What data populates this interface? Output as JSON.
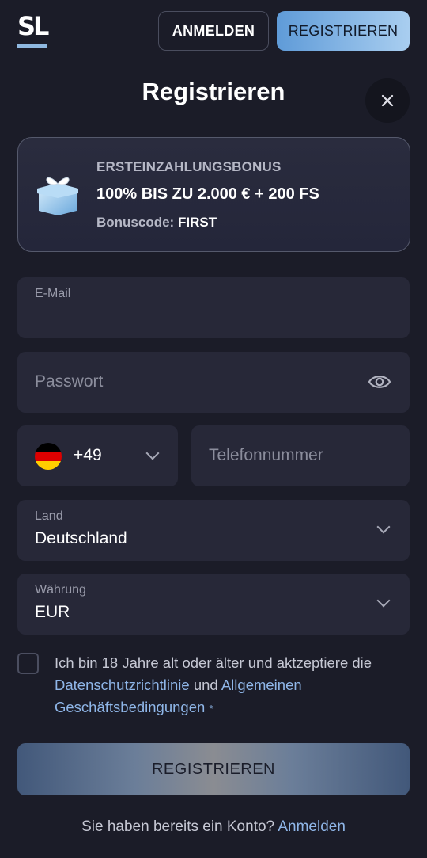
{
  "header": {
    "logo_text": "SL",
    "login_label": "ANMELDEN",
    "register_label": "REGISTRIEREN"
  },
  "page": {
    "title": "Registrieren",
    "close_icon": "close-icon"
  },
  "bonus": {
    "kicker": "ERSTEINZAHLUNGSBONUS",
    "headline": "100% BIS ZU 2.000 € + 200 FS",
    "code_label": "Bonuscode:",
    "code_value": "FIRST",
    "icon": "gift-icon"
  },
  "form": {
    "email": {
      "label": "E-Mail",
      "value": ""
    },
    "password": {
      "placeholder": "Passwort",
      "icon": "eye-icon"
    },
    "phone": {
      "country_code": "+49",
      "flag": "germany-flag",
      "placeholder": "Telefonnummer"
    },
    "country": {
      "label": "Land",
      "value": "Deutschland"
    },
    "currency": {
      "label": "Währung",
      "value": "EUR"
    }
  },
  "terms": {
    "text_before": "Ich bin 18 Jahre alt oder älter und aktzeptiere die",
    "privacy_link": "Datenschutzrichtlinie",
    "middle": "und",
    "terms_link": "Allgemeinen Geschäftsbedingungen",
    "required_mark": "*"
  },
  "submit_label": "REGISTRIEREN",
  "footer": {
    "text": "Sie haben bereits ein Konto?",
    "link": "Anmelden"
  },
  "colors": {
    "background": "#1b1c28",
    "field": "#272838",
    "accent": "#8fb6e8",
    "flag_black": "#000000",
    "flag_red": "#dd0000",
    "flag_gold": "#ffce00"
  }
}
